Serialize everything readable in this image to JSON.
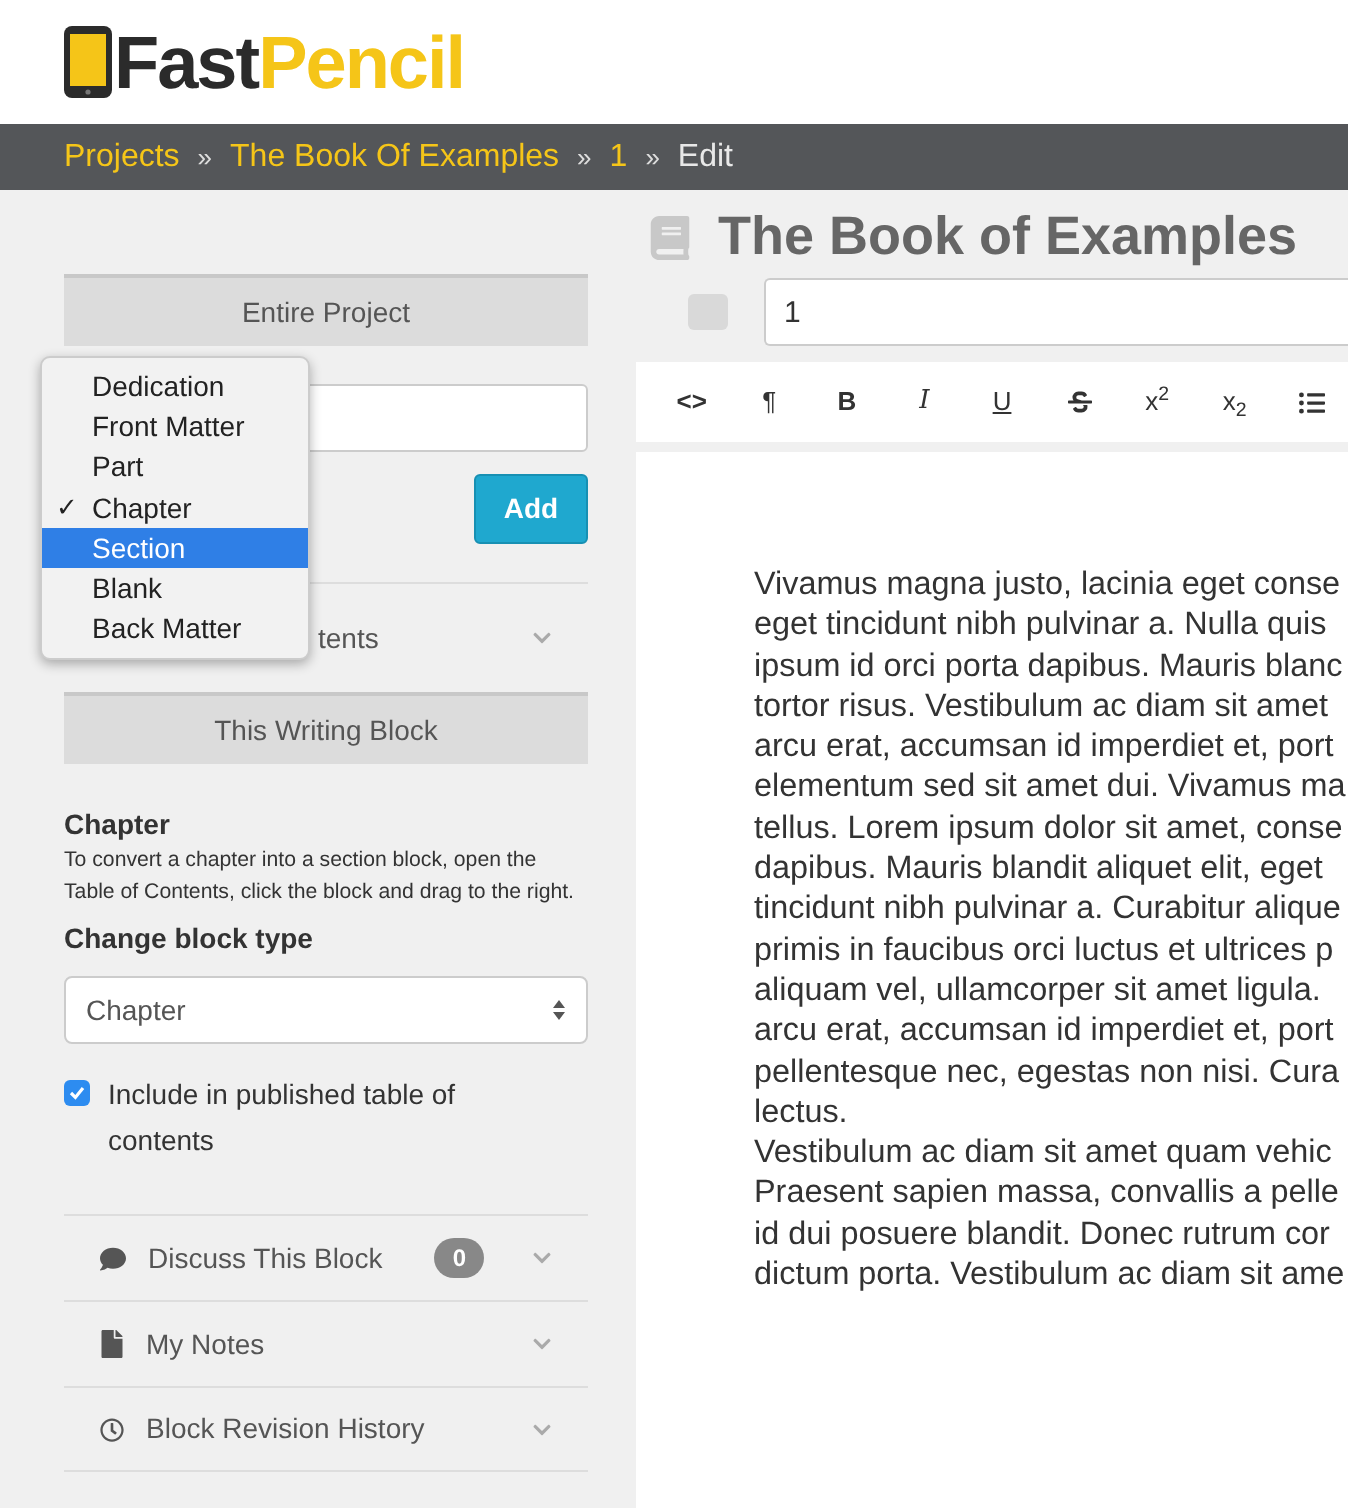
{
  "logo": {
    "part_1": "Fast",
    "part_2": "Pencil"
  },
  "breadcrumb": [
    {
      "label": "Projects",
      "kind": "link"
    },
    {
      "label": "The Book Of Examples",
      "kind": "link"
    },
    {
      "label": "1",
      "kind": "link"
    },
    {
      "label": "Edit",
      "kind": "current"
    }
  ],
  "breadcrumb_separator": "»",
  "sidebar": {
    "entire_project": {
      "header": "Entire Project",
      "add_button": "Add",
      "toc_row_label": "tents"
    },
    "block_type_menu": [
      {
        "label": "Dedication",
        "checked": false,
        "selected": false
      },
      {
        "label": "Front Matter",
        "checked": false,
        "selected": false
      },
      {
        "label": "Part",
        "checked": false,
        "selected": false
      },
      {
        "label": "Chapter",
        "checked": true,
        "selected": false
      },
      {
        "label": "Section",
        "checked": false,
        "selected": true
      },
      {
        "label": "Blank",
        "checked": false,
        "selected": false
      },
      {
        "label": "Back Matter",
        "checked": false,
        "selected": false
      }
    ],
    "check_mark": "✓",
    "writing_block": {
      "header": "This Writing Block",
      "title": "Chapter",
      "description": "To convert a chapter into a section block, open the Table of Contents, click the block and drag to the right.",
      "change_type_label": "Change block type",
      "block_type_value": "Chapter",
      "include_in_toc": {
        "label": "Include in published table of contents",
        "checked": true
      }
    },
    "accordion": [
      {
        "label": "Discuss This Block",
        "kind": "discuss",
        "badge": "0"
      },
      {
        "label": "My Notes",
        "kind": "notes"
      },
      {
        "label": "Block Revision History",
        "kind": "history"
      }
    ]
  },
  "editor": {
    "book_title": "The Book of Examples",
    "block_title_value": "1",
    "toolbar": [
      {
        "label": "<>",
        "kind": "code"
      },
      {
        "label": "¶",
        "kind": "paragraph"
      },
      {
        "label": "B",
        "kind": "bold"
      },
      {
        "label": "I",
        "kind": "italic"
      },
      {
        "label": "U",
        "kind": "underline"
      },
      {
        "kind": "strike"
      },
      {
        "label": "x$^{2}$",
        "kind": "superscript"
      },
      {
        "label": "x$_{2}$",
        "kind": "subscript"
      },
      {
        "kind": "list"
      }
    ],
    "lines": [
      "Vivamus magna justo, lacinia eget conse",
      "eget tincidunt nibh pulvinar a. Nulla quis",
      "ipsum id orci porta dapibus. Mauris blanc",
      "tortor risus. Vestibulum ac diam sit amet",
      "arcu erat, accumsan id imperdiet et, port",
      "elementum sed sit amet dui. Vivamus ma",
      "tellus. Lorem ipsum dolor sit amet, conse",
      "dapibus. Mauris blandit aliquet elit, eget",
      "tincidunt nibh pulvinar a. Curabitur alique",
      "primis in faucibus orci luctus et ultrices p",
      "aliquam vel, ullamcorper sit amet ligula.",
      "arcu erat, accumsan id imperdiet et, port",
      "pellentesque nec, egestas non nisi. Cura",
      "lectus.",
      "Vestibulum ac diam sit amet quam vehic",
      "Praesent sapien massa, convallis a pelle",
      "id dui posuere blandit. Donec rutrum cor",
      "dictum porta. Vestibulum ac diam sit ame"
    ]
  }
}
